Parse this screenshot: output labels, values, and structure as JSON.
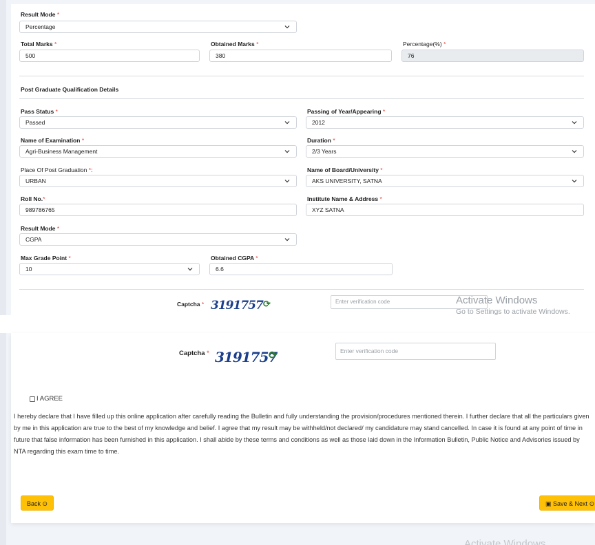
{
  "top_form": {
    "result_mode": {
      "label": "Result Mode",
      "value": "Percentage"
    },
    "total_marks": {
      "label": "Total Marks",
      "value": "500"
    },
    "obtained_marks": {
      "label": "Obtained Marks",
      "value": "380"
    },
    "percentage": {
      "label": "Percentage(%)",
      "value": "76"
    }
  },
  "pg_section": {
    "title": "Post Graduate Qualification Details",
    "pass_status": {
      "label": "Pass Status",
      "value": "Passed"
    },
    "passing_year": {
      "label": "Passing of Year/Appearing",
      "value": "2012"
    },
    "exam_name": {
      "label": "Name of Examination",
      "value": "Agri-Business Management"
    },
    "duration": {
      "label": "Duration",
      "value": "2/3 Years"
    },
    "place": {
      "label": "Place Of Post Graduation",
      "suffix": ":",
      "value": "URBAN"
    },
    "board": {
      "label": "Name of Board/University",
      "value": "AKS UNIVERSITY, SATNA"
    },
    "roll_no": {
      "label": "Roll No.",
      "value": "989786765"
    },
    "institute": {
      "label": "Institute Name & Address",
      "value": "XYZ SATNA"
    },
    "result_mode": {
      "label": "Result Mode",
      "value": "CGPA"
    },
    "max_grade": {
      "label": "Max Grade Point",
      "value": "10"
    },
    "obtained_cgpa": {
      "label": "Obtained CGPA",
      "value": "6.6"
    }
  },
  "required_mark": "*",
  "captcha": {
    "label": "Captcha",
    "code": "3191757",
    "placeholder": "Enter verification code",
    "refresh_glyph": "⟳"
  },
  "watermark": {
    "line1": "Activate Windows",
    "line2": "Go to Settings to activate Windows.",
    "line3": "Activate Windows"
  },
  "agreement": {
    "agree_label": "I AGREE",
    "declaration": "I hereby declare that I have filled up this online application after carefully reading the Bulletin and fully understanding the provision/procedures mentioned therein. I further declare that all the particulars given by me in this application are true to the best of my knowledge and belief. I agree that my result may be withheld/not declared/ my candidature may stand cancelled. In case it is found at any point of time in future that false information has been furnished in this application. I shall abide by these terms and conditions as well as those laid down in the Information Bulletin, Public Notice and Advisories issued by NTA regarding this exam time to time."
  },
  "buttons": {
    "back": "Back",
    "save_next": "Save & Next"
  },
  "colors": {
    "accent": "#ffc107",
    "required": "#e53935",
    "captcha": "#1b3f8c",
    "refresh": "#2e7d32"
  }
}
